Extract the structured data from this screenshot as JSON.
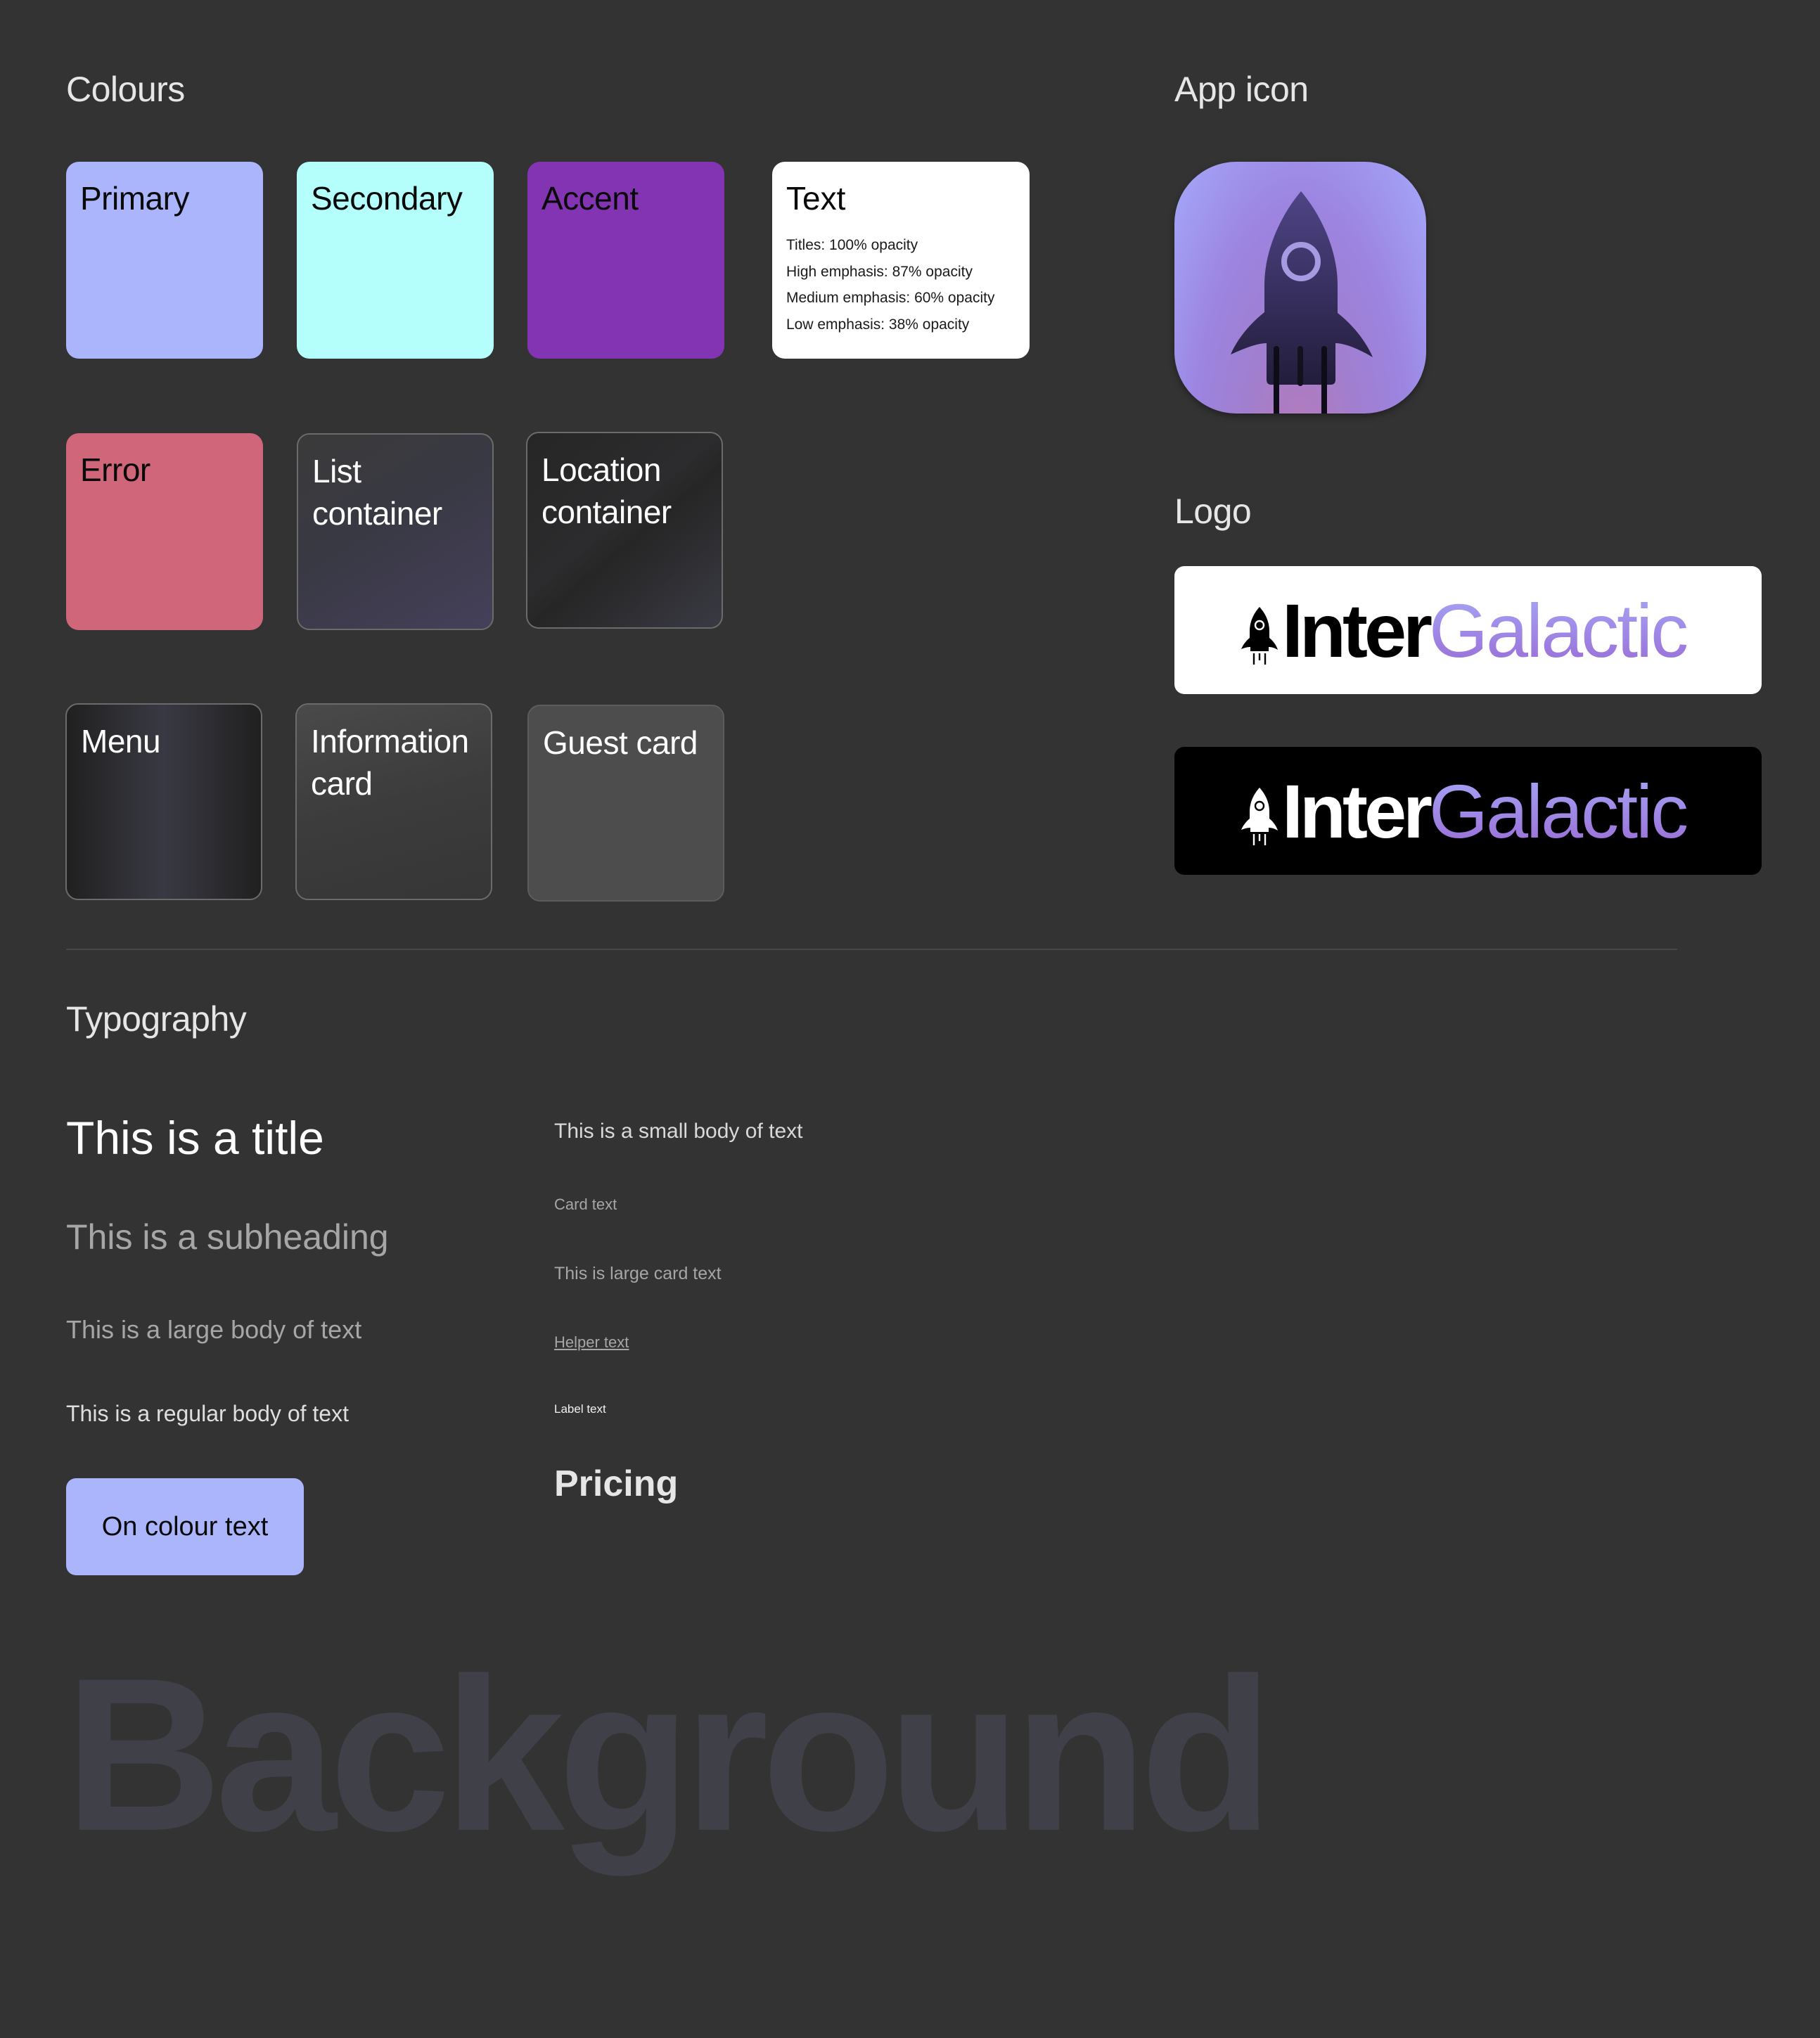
{
  "colours": {
    "heading": "Colours",
    "swatches": [
      {
        "name": "Primary",
        "color": "#aab5fc"
      },
      {
        "name": "Secondary",
        "color": "#b4fffb"
      },
      {
        "name": "Accent",
        "color": "#8334b3"
      },
      {
        "name": "Error",
        "color": "#cf6679"
      },
      {
        "name": "List container",
        "line1": "List",
        "line2": "container",
        "color": "#3a3946"
      },
      {
        "name": "Location container",
        "line1": "Location",
        "line2": "container",
        "color": "#2a2a2c"
      },
      {
        "name": "Menu",
        "color": "#2b2b30"
      },
      {
        "name": "Information card",
        "line1": "Information",
        "line2": "card",
        "color": "#3d3d3d"
      },
      {
        "name": "Guest card",
        "color": "#4d4d4d"
      }
    ],
    "text_card": {
      "title": "Text",
      "lines": [
        "Titles: 100% opacity",
        "High emphasis: 87% opacity",
        "Medium emphasis: 60% opacity",
        "Low emphasis: 38% opacity"
      ],
      "opacities": [
        1.0,
        0.87,
        0.6,
        0.38
      ]
    }
  },
  "app_icon": {
    "heading": "App icon",
    "icon": "rocket-icon"
  },
  "logo": {
    "heading": "Logo",
    "word1": "Inter",
    "word2": "Galactic",
    "variants": [
      "light",
      "dark"
    ]
  },
  "typography": {
    "heading": "Typography",
    "left": {
      "title": "This is a title",
      "subheading": "This is a subheading",
      "large_body": "This is a large body of text",
      "regular_body": "This is a regular body of text",
      "on_colour": "On colour text"
    },
    "right": {
      "small_body": "This is a small body of text",
      "card_text": "Card text",
      "large_card_text": "This is large card text",
      "helper_text": "Helper text",
      "label_text": "Label text",
      "pricing": "Pricing"
    }
  },
  "background": {
    "label": "Background",
    "color": "#333333"
  }
}
